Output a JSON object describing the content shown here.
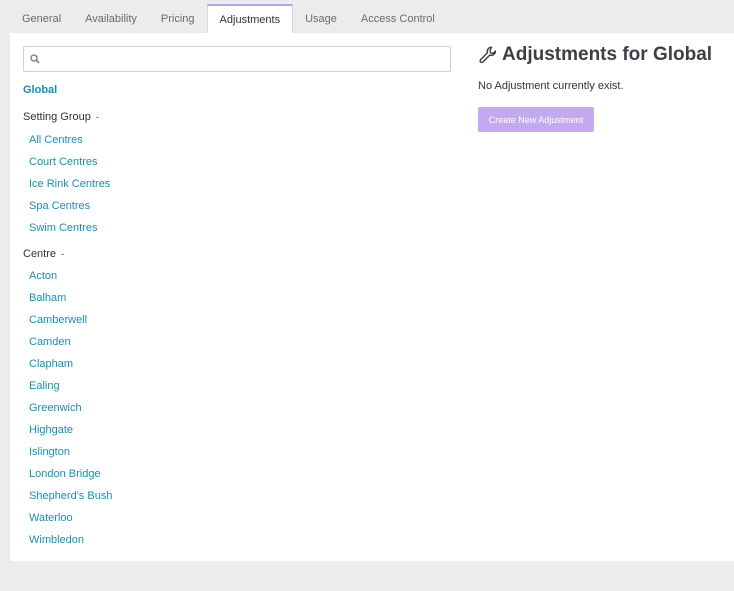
{
  "tabs": [
    "General",
    "Availability",
    "Pricing",
    "Adjustments",
    "Usage",
    "Access Control"
  ],
  "active_tab": "Adjustments",
  "search": {
    "placeholder": "",
    "value": ""
  },
  "sidebar": {
    "global_label": "Global",
    "setting_group": {
      "label": "Setting Group",
      "caret": "-",
      "items": [
        "All Centres",
        "Court Centres",
        "Ice Rink Centres",
        "Spa Centres",
        "Swim Centres"
      ]
    },
    "centre": {
      "label": "Centre",
      "caret": "-",
      "items": [
        "Acton",
        "Balham",
        "Camberwell",
        "Camden",
        "Clapham",
        "Ealing",
        "Greenwich",
        "Highgate",
        "Islington",
        "London Bridge",
        "Shepherd's Bush",
        "Waterloo",
        "Wimbledon"
      ]
    }
  },
  "main": {
    "icon": "wrench-icon",
    "title": "Adjustments for Global",
    "empty_message": "No Adjustment currently exist.",
    "create_button_label": "Create New Adjustment"
  },
  "colors": {
    "link": "#1a8fb3",
    "accent": "#b7a2e8",
    "button": "#c3aaf0",
    "background": "#ececec"
  }
}
